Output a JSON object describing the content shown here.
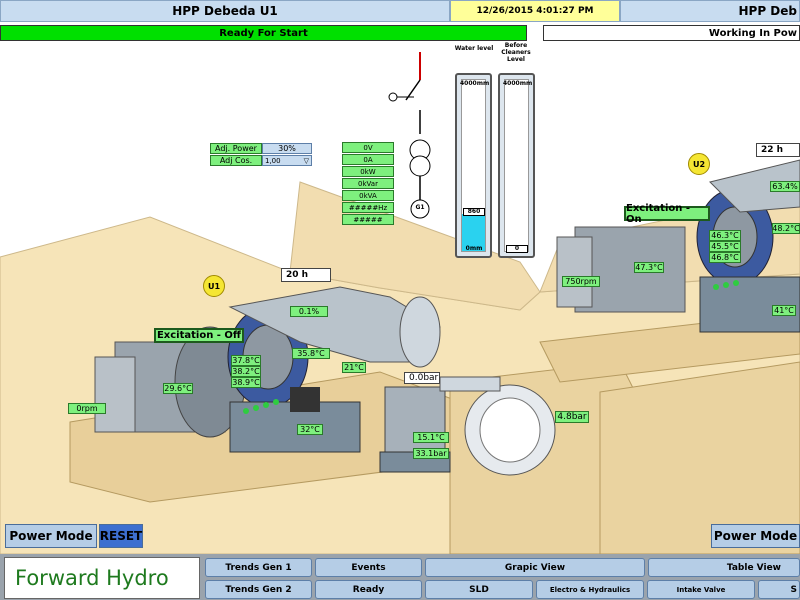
{
  "header": {
    "unit1_title": "HPP Debeda U1",
    "datetime": "12/26/2015 4:01:27 PM",
    "unit2_title": "HPP Deb"
  },
  "status": {
    "unit1": "Ready For Start",
    "unit2": "Working In Pow"
  },
  "colors": {
    "status_green": "#00e000",
    "header_blue": "#c8dcf0",
    "datetime_yellow": "#ffff99",
    "tag_green": "#7ef07e",
    "ground": "#f6e4b8",
    "water": "#2ad2ef",
    "reset_blue": "#3d6fd0",
    "footer_gray": "#9aa3ac"
  },
  "controls": {
    "adj_power_label": "Adj. Power",
    "adj_power_value": "30%",
    "adj_cos_label": "Adj Cos.",
    "adj_cos_value": "1,00"
  },
  "readouts": [
    "0V",
    "0A",
    "0kW",
    "0kVar",
    "0kVA",
    "#####Hz",
    "#####"
  ],
  "sld": {
    "generator_label": "G1"
  },
  "tanks": {
    "water_level_label": "Water level",
    "before_cleaners_label": "Before Cleaners Level",
    "water_top": "4000mm",
    "water_bottom": "0mm",
    "water_value": "860",
    "water_fill_fraction": 0.215,
    "cleaners_top": "4000mm",
    "cleaners_value": "0",
    "cleaners_fill_fraction": 0.0
  },
  "unit1": {
    "badge": "U1",
    "hours": "20 h",
    "excitation": "Excitation - Off",
    "open_pct": "0.1%",
    "temp_bearing": "35.8°C",
    "temps_winding": [
      "37.8°C",
      "38.2°C",
      "38.9°C"
    ],
    "temp_generator": "29.6°C",
    "temp_oil": "21°C",
    "temp_hpu": "32°C",
    "speed": "0rpm",
    "pressure_small": "0.0bar",
    "pressure_large": "4.8bar",
    "temp_valve": "15.1°C",
    "pressure_valve": "33.1bar"
  },
  "unit2": {
    "badge": "U2",
    "hours": "22 h",
    "excitation": "Excitation - On",
    "open_pct": "63.4%",
    "temp_bearing": "48.2°C",
    "temps_winding": [
      "46.3°C",
      "45.5°C",
      "46.8°C"
    ],
    "temp_generator": "47.3°C",
    "temp_oil": "41°C",
    "speed": "750rpm"
  },
  "buttons": {
    "power_mode_left": "Power Mode",
    "reset": "RESET",
    "power_mode_right": "Power Mode"
  },
  "footer": {
    "brand": "Forward Hydro",
    "nav_row1": [
      "Trends Gen 1",
      "Events",
      "Grapic View",
      "Table View"
    ],
    "nav_row2": [
      "Trends Gen 2",
      "Ready",
      "SLD",
      "Electro & Hydraulics",
      "Intake Valve",
      "S"
    ]
  }
}
